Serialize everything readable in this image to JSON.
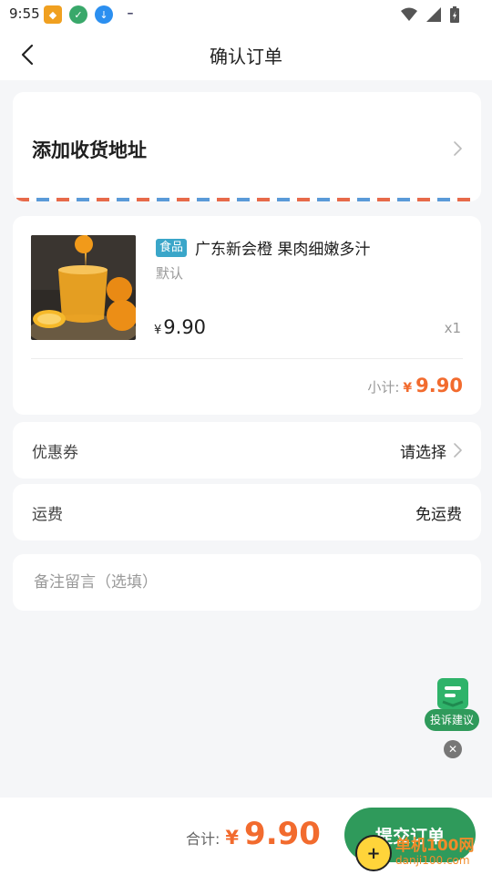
{
  "status_bar": {
    "time": "9:55"
  },
  "header": {
    "title": "确认订单"
  },
  "address": {
    "label": "添加收货地址"
  },
  "product": {
    "tag": "食品",
    "name": "广东新会橙 果肉细嫩多汁",
    "variant": "默认",
    "currency": "¥",
    "price": "9.90",
    "quantity": "x1",
    "subtotal_label": "小计:",
    "subtotal_currency": "¥",
    "subtotal": "9.90"
  },
  "coupon": {
    "label": "优惠券",
    "value": "请选择"
  },
  "shipping": {
    "label": "运费",
    "value": "免运费"
  },
  "remark": {
    "placeholder": "备注留言（选填）"
  },
  "complaint": {
    "label": "投诉建议"
  },
  "bottom": {
    "total_label": "合计:",
    "currency": "¥",
    "total": "9.90",
    "submit_label": "提交订单"
  },
  "watermark": {
    "cn": "单机100网",
    "en": "danji100.com"
  },
  "colors": {
    "accent_green": "#2f9a5b",
    "price_orange": "#f26b2e",
    "tag_blue": "#3aa6c9"
  }
}
